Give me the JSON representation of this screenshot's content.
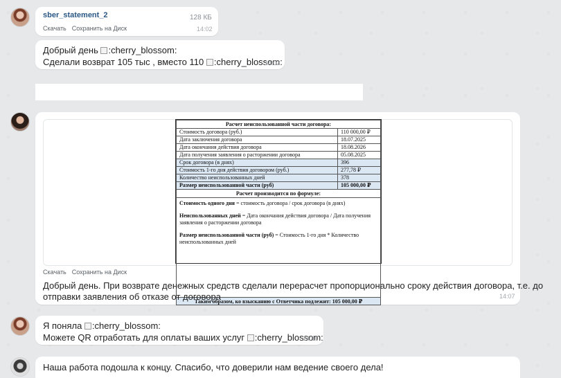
{
  "messages": {
    "m1": {
      "file_name": "sber_statement_2",
      "file_size": "128 КБ",
      "download_label": "Скачать",
      "save_label": "Сохранить на Диск",
      "time": "14:02"
    },
    "m2": {
      "line1": "Добрый день",
      "line2": "Сделали возврат 105 тыс , вместо 110",
      "emoji_text": ":cherry_blossom:",
      "time": "14:02"
    },
    "m3": {
      "download_label": "Скачать",
      "save_label": "Сохранить на Диск",
      "text_line1": "Добрый день. При возврате денежных средств сделали перерасчет пропорционально сроку действия договора, т.е. до",
      "text_line2": "отправки заявления об отказе от договора",
      "time": "14:07"
    },
    "m4": {
      "line1": "Я поняла",
      "line2": "Можете QR отработать для оплаты ваших услуг",
      "emoji_text": ":cherry_blossom:",
      "time": "14:10"
    },
    "m5": {
      "text": "Наша работа подошла к концу. Спасибо, что доверили нам ведение своего дела!"
    }
  },
  "document": {
    "title": "Расчет неиспользованной части договора:",
    "rows": [
      {
        "label": "Стоимость договора (руб.)",
        "value": "110 000,00 ₽"
      },
      {
        "label": "Дата заключения договора",
        "value": "18.07.2025"
      },
      {
        "label": "Дата окончания действия договора",
        "value": "18.08.2026"
      },
      {
        "label": "Дата получения заявления о расторжении договора",
        "value": "05.08.2025"
      },
      {
        "label": "Срок договора (в днях)",
        "value": "396"
      },
      {
        "label": "Стоимость 1-го дня действия договором (руб.)",
        "value": "277,78 ₽"
      },
      {
        "label": "Количество неиспользованных дней",
        "value": "378"
      },
      {
        "label": "Размер неиспользованной части (руб)",
        "value": "105 000,00 ₽"
      }
    ],
    "formula_title": "Расчет производится по формуле:",
    "f1_bold": "Стоимость одного дня",
    "f1_rest": " = стоимость договора / срок договора (в днях)",
    "f2_bold": "Неиспользованных дней",
    "f2_rest": " = Дата окончания действия договора / Дата получения заявления о расторжении договора",
    "f3_bold": "Размер неиспользованной части (руб)",
    "f3_rest": " = Стоимость 1-го дня * Количество неиспользованных дней",
    "final": "Таким образом, ко взысканию с Ответчика подлежит: 105 000,00 ₽"
  }
}
